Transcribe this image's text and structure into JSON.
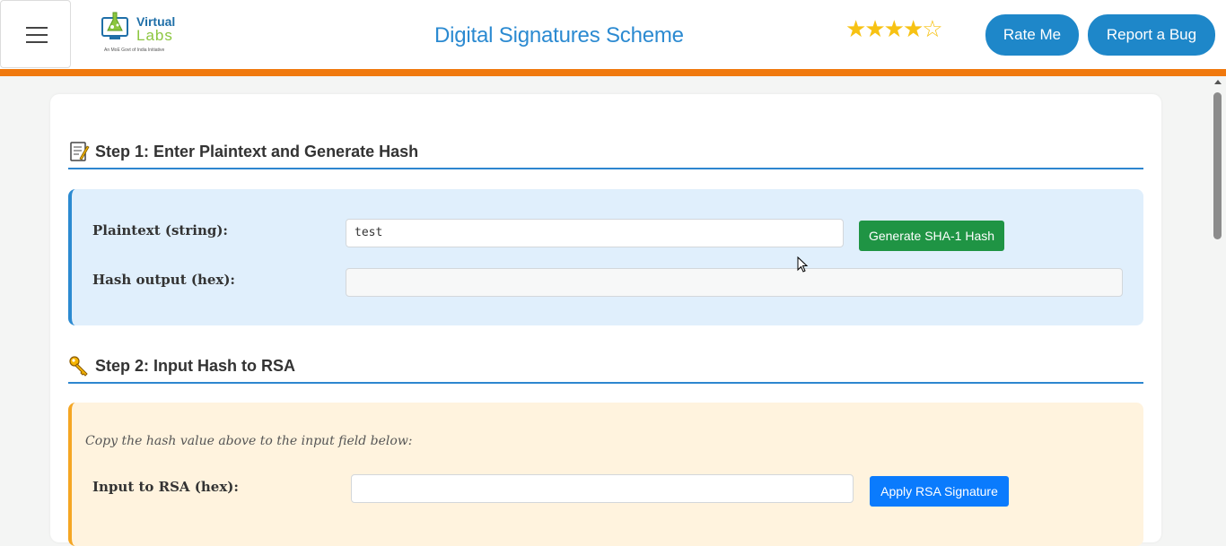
{
  "header": {
    "logo": {
      "word1": "Virtual",
      "word2": "Labs",
      "tagline": "An MoE Govt of India Initiative"
    },
    "title": "Digital Signatures Scheme",
    "rating": {
      "value": 4,
      "max": 5
    },
    "rate_label": "Rate Me",
    "bug_label": "Report a Bug"
  },
  "step1": {
    "title": "Step 1: Enter Plaintext and Generate Hash",
    "plaintext_label": "Plaintext (string):",
    "plaintext_value": "test",
    "generate_label": "Generate SHA-1 Hash",
    "hash_label": "Hash output (hex):",
    "hash_value": ""
  },
  "step2": {
    "title": "Step 2: Input Hash to RSA",
    "hint": "Copy the hash value above to the input field below:",
    "rsa_input_label": "Input to RSA (hex):",
    "rsa_input_value": "",
    "apply_label": "Apply RSA Signature"
  },
  "colors": {
    "accent_orange": "#f0790e",
    "title_blue": "#2b8ad1",
    "header_button": "#1e87c9",
    "generate_button": "#1f9444",
    "apply_button": "#0a7bfd",
    "star": "#f7c213"
  }
}
